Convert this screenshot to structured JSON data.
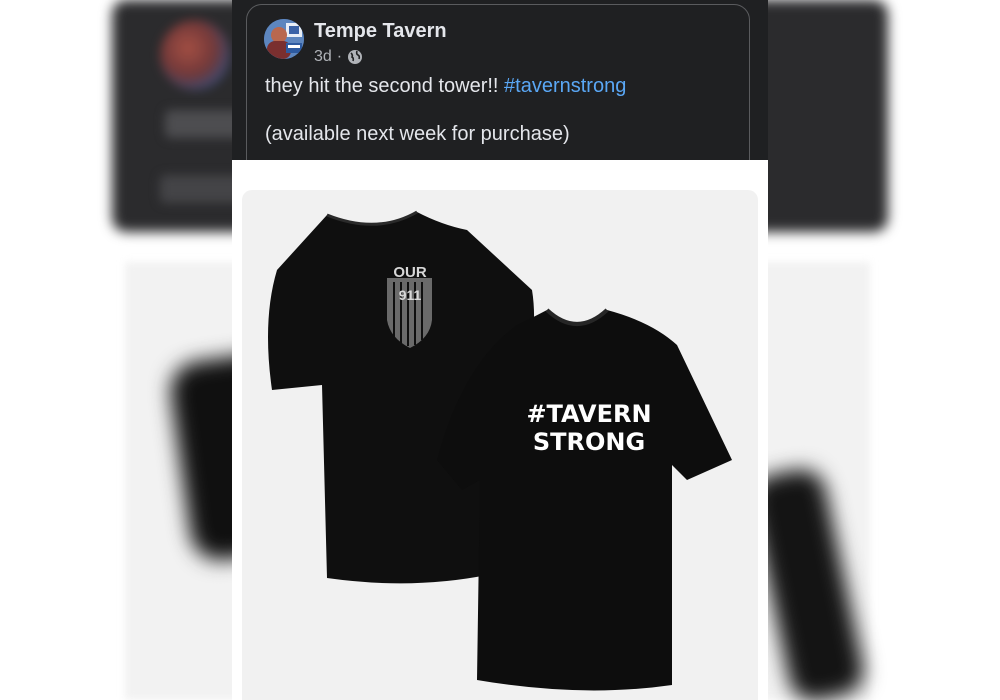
{
  "post": {
    "author": "Tempe Tavern",
    "timestamp": "3d",
    "separator": "·",
    "audience_icon": "globe-icon",
    "text_main": "they hit the second tower!! ",
    "hashtag": "#tavernstrong",
    "text_secondary": "(available next week for purchase)"
  },
  "image": {
    "back_shirt_text_top": "OUR",
    "back_shirt_text_bottom": "911",
    "front_shirt_line1": "#TAVERN",
    "front_shirt_line2": "STRONG"
  },
  "colors": {
    "post_bg": "#1f2022",
    "text": "#e4e6eb",
    "muted": "#b0b3b8",
    "hashtag": "#5aa7f5",
    "shirt": "#0d0d0d"
  }
}
